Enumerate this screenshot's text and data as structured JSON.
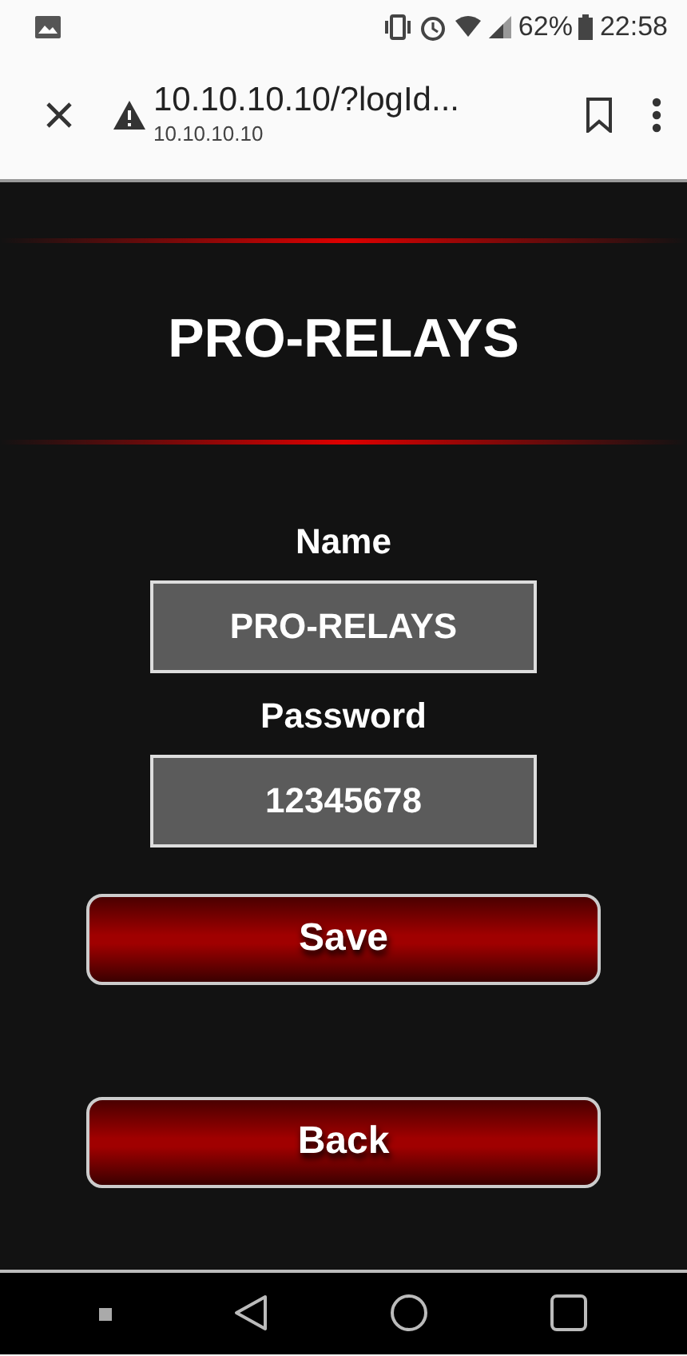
{
  "status_bar": {
    "battery": "62%",
    "time": "22:58"
  },
  "browser": {
    "title": "10.10.10.10/?logId...",
    "url": "10.10.10.10"
  },
  "page": {
    "title": "PRO-RELAYS",
    "fields": [
      {
        "label": "Name",
        "value": "PRO-RELAYS"
      },
      {
        "label": "Password",
        "value": "12345678"
      }
    ],
    "buttons": [
      {
        "label": "Save"
      },
      {
        "label": "Back"
      }
    ]
  }
}
